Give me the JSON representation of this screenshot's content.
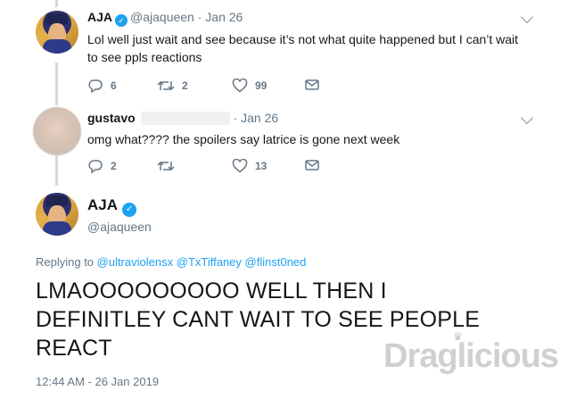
{
  "tweets": [
    {
      "name": "AJA",
      "handle": "@ajaqueen",
      "dot": "·",
      "date": "Jan 26",
      "text_line1": "Lol well just wait and see because it’s not what quite happened but I can’t wait",
      "text_line2": "to see ppls reactions",
      "replies": "6",
      "retweets": "2",
      "likes": "99"
    },
    {
      "name": "gustavo",
      "dot": "·",
      "date": "Jan 26",
      "text": "omg what???? the spoilers say latrice is gone next week",
      "replies": "2",
      "retweets": "",
      "likes": "13"
    }
  ],
  "main": {
    "name": "AJA",
    "handle": "@ajaqueen",
    "replying_prefix": "Replying to",
    "mentions": [
      "@ultraviolensx",
      "@TxTiffaney",
      "@flinst0ned"
    ],
    "text_line1": "LMAOOOOOOOOO WELL THEN I",
    "text_line2": "DEFINITLEY CANT WAIT TO SEE PEOPLE",
    "text_line3": "REACT",
    "timestamp": "12:44 AM - 26 Jan 2019"
  },
  "icons": {
    "verified": "verified-badge-icon",
    "reply": "reply-icon",
    "retweet": "retweet-icon",
    "like": "heart-icon",
    "dm": "envelope-icon",
    "more": "chevron-down-icon"
  },
  "colors": {
    "accent": "#1da1f2",
    "muted": "#657786",
    "text": "#14171a"
  },
  "watermark": {
    "text": "Draglicious"
  }
}
